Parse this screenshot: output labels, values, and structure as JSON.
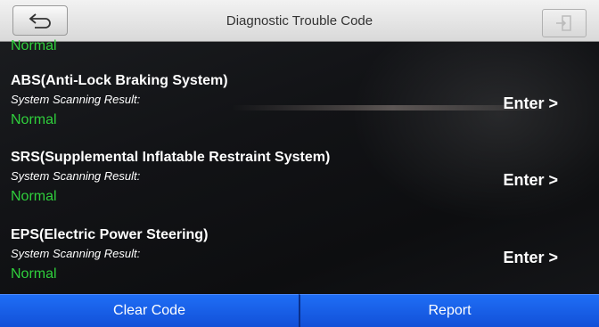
{
  "header": {
    "title": "Diagnostic Trouble Code",
    "back_icon": "back-arrow-icon",
    "exit_icon": "exit-door-icon"
  },
  "colors": {
    "header_bg": "#e6e6e6",
    "status_normal": "#2fcf3c",
    "footer_button": "#1a5fe8",
    "text": "#ffffff"
  },
  "partial_status": "Normal",
  "modules": [
    {
      "title": "ABS(Anti-Lock Braking System)",
      "subtitle": "System Scanning Result:",
      "status": "Normal",
      "action": "Enter >"
    },
    {
      "title": "SRS(Supplemental Inflatable Restraint System)",
      "subtitle": "System Scanning Result:",
      "status": "Normal",
      "action": "Enter >"
    },
    {
      "title": "EPS(Electric Power Steering)",
      "subtitle": "System Scanning Result:",
      "status": "Normal",
      "action": "Enter >"
    }
  ],
  "footer": {
    "clear_code_label": "Clear Code",
    "report_label": "Report"
  }
}
